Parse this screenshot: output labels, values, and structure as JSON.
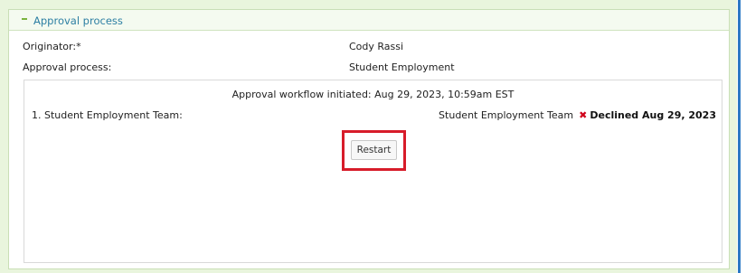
{
  "panel": {
    "title": "Approval process"
  },
  "fields": {
    "originator_label": "Originator:*",
    "originator_value": "Cody Rassi",
    "approval_process_label": "Approval process:",
    "approval_process_value": "Student Employment"
  },
  "workflow": {
    "initiated_text": "Approval workflow initiated: Aug 29, 2023, 10:59am EST",
    "steps": [
      {
        "label": "1. Student Employment Team:",
        "assignee": "Student Employment Team",
        "status": "Declined Aug 29, 2023",
        "status_icon": "x-icon"
      }
    ],
    "restart_label": "Restart"
  },
  "colors": {
    "accent_title": "#2d7fa3",
    "outer_background": "#e9f5dd",
    "declined_icon": "#d0021b",
    "highlight": "#d71c2a"
  }
}
